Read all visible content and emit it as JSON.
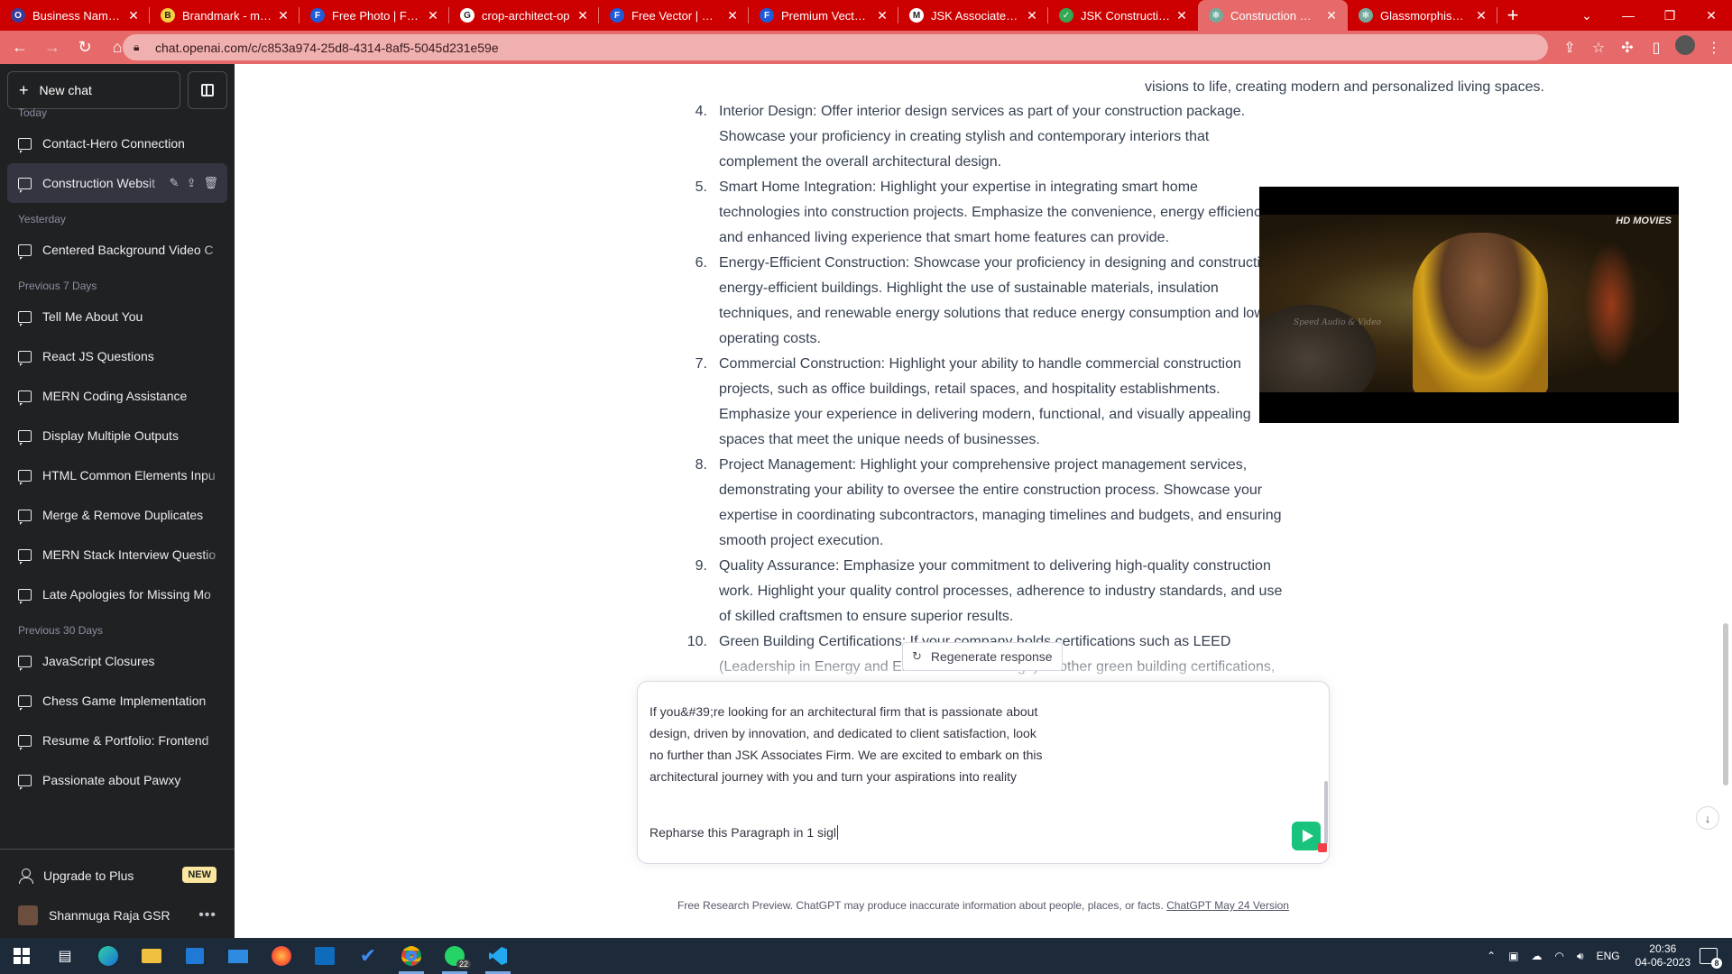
{
  "browser": {
    "tabs": [
      {
        "title": "Business Name Ge",
        "favicon": "brandcrowd-icon",
        "color": "#3b3b98",
        "glyph": "O"
      },
      {
        "title": "Brandmark - make",
        "favicon": "brandmark-icon",
        "color": "#f4d03f",
        "glyph": "B"
      },
      {
        "title": "Free Photo | Free p",
        "favicon": "freepik-icon",
        "color": "#1f5bd8",
        "glyph": "F"
      },
      {
        "title": "crop-architect-op",
        "favicon": "github-icon",
        "color": "#ffffff",
        "glyph": "G"
      },
      {
        "title": "Free Vector | Cinen",
        "favicon": "freepik-icon",
        "color": "#1f5bd8",
        "glyph": "F"
      },
      {
        "title": "Premium Vector | N",
        "favicon": "freepik-icon",
        "color": "#1f5bd8",
        "glyph": "F"
      },
      {
        "title": "JSK Associates Firm",
        "favicon": "gmail-icon",
        "color": "#ffffff",
        "glyph": "M"
      },
      {
        "title": "JSK Constructions",
        "favicon": "check-icon",
        "color": "#34a853",
        "glyph": "✓"
      },
      {
        "title": "Construction Webs",
        "favicon": "openai-icon",
        "color": "#74aa9c",
        "glyph": "✻"
      },
      {
        "title": "Glassmorphism CS",
        "favicon": "openai-icon",
        "color": "#74aa9c",
        "glyph": "✻"
      }
    ],
    "active_tab_index": 8,
    "url": "chat.openai.com/c/c853a974-25d8-4314-8af5-5045d231e59e",
    "tab_bar_color": "#cc0000",
    "toolbar_color": "#e66a6a"
  },
  "sidebar": {
    "new_chat_label": "New chat",
    "groups": [
      {
        "label": "Today",
        "items": [
          "Contact-Hero Connection",
          "Construction Websit"
        ]
      },
      {
        "label": "Yesterday",
        "items": [
          "Centered Background Video C"
        ]
      },
      {
        "label": "Previous 7 Days",
        "items": [
          "Tell Me About You",
          "React JS Questions",
          "MERN Coding Assistance",
          "Display Multiple Outputs",
          "HTML Common Elements Inpu",
          "Merge & Remove Duplicates",
          "MERN Stack Interview Questio",
          "Late Apologies for Missing Mo"
        ]
      },
      {
        "label": "Previous 30 Days",
        "items": [
          "JavaScript Closures",
          "Chess Game Implementation",
          "Resume & Portfolio: Frontend",
          "Passionate about Pawxy"
        ]
      }
    ],
    "active_item": "Construction Websit",
    "upgrade_label": "Upgrade to Plus",
    "upgrade_badge": "NEW",
    "user_name": "Shanmuga Raja GSR"
  },
  "answer": {
    "partial_line": "visions to life, creating modern and personalized living spaces.",
    "items": [
      {
        "num": "4.",
        "lines": [
          "Interior Design: Offer interior design services as part of your construction package.",
          "Showcase your proficiency in creating stylish and contemporary interiors that",
          "complement the overall architectural design."
        ]
      },
      {
        "num": "5.",
        "lines": [
          "Smart Home Integration: Highlight your expertise in integrating smart home",
          "technologies into construction projects. Emphasize the convenience, energy efficiency,",
          "and enhanced living experience that smart home features can provide."
        ]
      },
      {
        "num": "6.",
        "lines": [
          "Energy-Efficient Construction: Showcase your proficiency in designing and constructing",
          "energy-efficient buildings. Highlight the use of sustainable materials, insulation",
          "techniques, and renewable energy solutions that reduce energy consumption and lower",
          "operating costs."
        ]
      },
      {
        "num": "7.",
        "lines": [
          "Commercial Construction: Highlight your ability to handle commercial construction",
          "projects, such as office buildings, retail spaces, and hospitality establishments.",
          "Emphasize your experience in delivering modern, functional, and visually appealing",
          "spaces that meet the unique needs of businesses."
        ]
      },
      {
        "num": "8.",
        "lines": [
          "Project Management: Highlight your comprehensive project management services,",
          "demonstrating your ability to oversee the entire construction process. Showcase your",
          "expertise in coordinating subcontractors, managing timelines and budgets, and ensuring",
          "smooth project execution."
        ]
      },
      {
        "num": "9.",
        "lines": [
          "Quality Assurance: Emphasize your commitment to delivering high-quality construction",
          "work. Highlight your quality control processes, adherence to industry standards, and use",
          "of skilled craftsmen to ensure superior results."
        ]
      },
      {
        "num": "10.",
        "lines": [
          "Green Building Certifications: If your company holds certifications such as LEED",
          "(Leadership in Energy and Environmental Design) or other green building certifications,"
        ]
      }
    ]
  },
  "video": {
    "logo_text": "HD MOVIES",
    "watermark": "Speed Audio & Video"
  },
  "composer": {
    "regenerate_label": "Regenerate response",
    "paragraph_lines": [
      "If you&#39;re looking for an architectural firm that is passionate about",
      "design, driven by innovation, and dedicated to client satisfaction, look",
      "no further than JSK Associates Firm. We are excited to embark on this",
      "architectural journey with you and turn your aspirations into reality"
    ],
    "typed_text": "Repharse this Paragraph in 1 sigl"
  },
  "footer": {
    "text": "Free Research Preview. ChatGPT may produce inaccurate information about people, places, or facts. ",
    "link": "ChatGPT May 24 Version"
  },
  "taskbar": {
    "apps": [
      "start-icon",
      "task-view-icon",
      "edge-icon",
      "file-explorer-icon",
      "store-icon",
      "mail-icon",
      "firefox-icon",
      "outlook-icon",
      "todo-icon",
      "chrome-icon",
      "whatsapp-icon",
      "vscode-icon"
    ],
    "whatsapp_badge": "22",
    "language": "ENG",
    "time": "20:36",
    "date": "04-06-2023",
    "notification_count": "8"
  }
}
